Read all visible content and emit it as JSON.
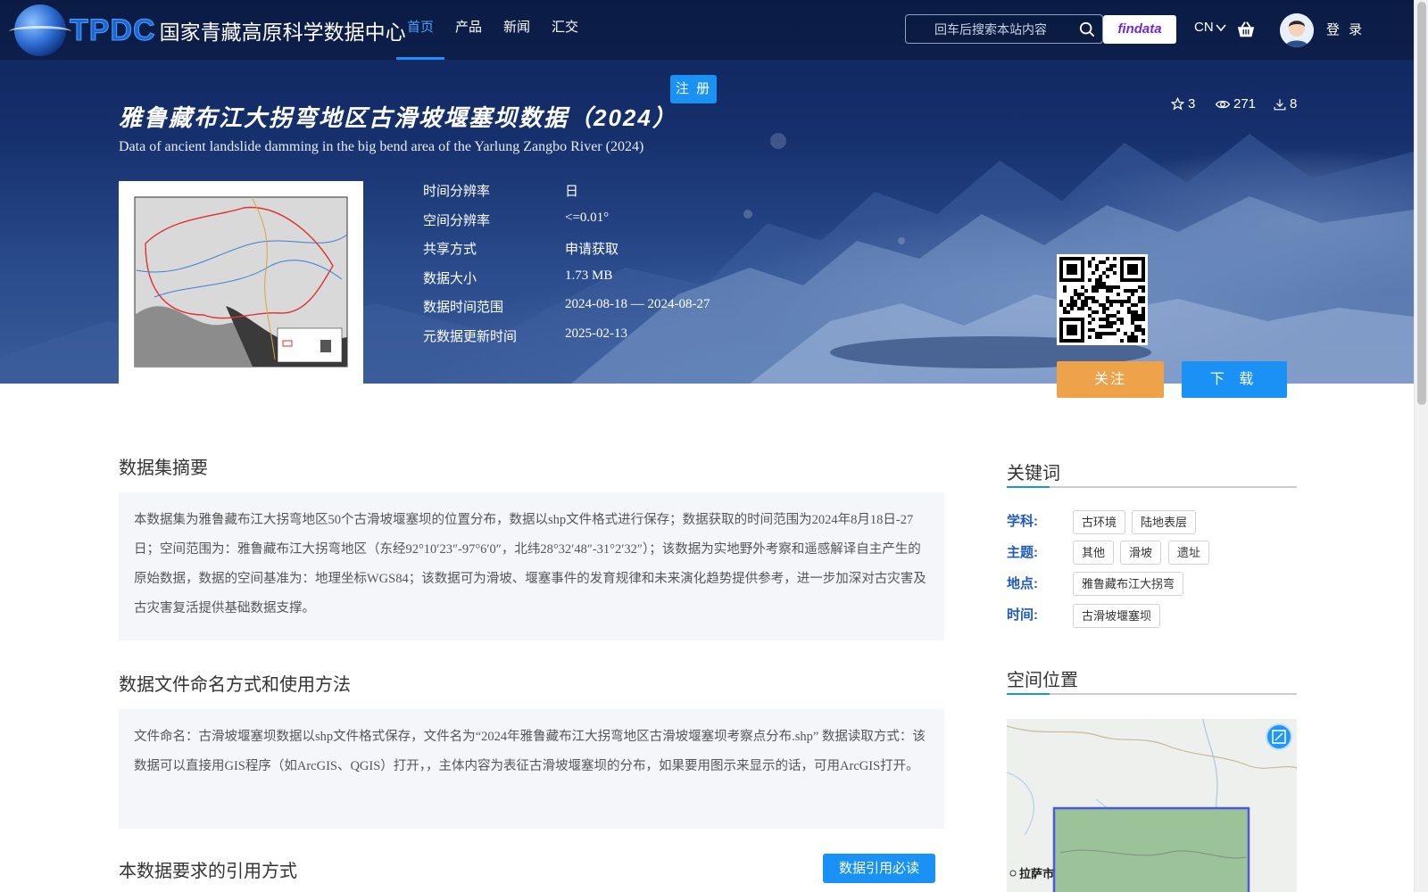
{
  "brand": {
    "logo_text": "TPDC",
    "site_name": "国家青藏高原科学数据中心"
  },
  "nav": {
    "items": [
      "首页",
      "产品",
      "新闻",
      "汇交"
    ],
    "active_index": 0
  },
  "header": {
    "search_placeholder": "回车后搜索本站内容",
    "findata_label": "findata",
    "lang_label": "CN",
    "login_label": "登 录",
    "register_label": "注 册"
  },
  "dataset": {
    "title_cn": "雅鲁藏布江大拐弯地区古滑坡堰塞坝数据（2024）",
    "title_en": "Data of ancient landslide damming in the big bend area of the Yarlung Zangbo River (2024)",
    "stats": {
      "stars": "3",
      "views": "271",
      "downloads": "8"
    },
    "meta": [
      {
        "key": "时间分辨率",
        "value": "日"
      },
      {
        "key": "空间分辨率",
        "value": "<=0.01°"
      },
      {
        "key": "共享方式",
        "value": "申请获取"
      },
      {
        "key": "数据大小",
        "value": "1.73 MB"
      },
      {
        "key": "数据时间范围",
        "value": "2024-08-18 — 2024-08-27"
      },
      {
        "key": "元数据更新时间",
        "value": "2025-02-13"
      }
    ],
    "follow_label": "关注",
    "download_label": "下 载"
  },
  "sections": {
    "abstract_title": "数据集摘要",
    "abstract_text": "本数据集为雅鲁藏布江大拐弯地区50个古滑坡堰塞坝的位置分布，数据以shp文件格式进行保存；数据获取的时间范围为2024年8月18日-27日；空间范围为：雅鲁藏布江大拐弯地区（东经92°10′23″-97°6′0″，北纬28°32′48″-31°2′32″）；该数据为实地野外考察和遥感解译自主产生的原始数据，数据的空间基准为：地理坐标WGS84；该数据可为滑坡、堰塞事件的发育规律和未来演化趋势提供参考，进一步加深对古灾害及古灾害复活提供基础数据支撑。",
    "naming_title": "数据文件命名方式和使用方法",
    "naming_text": "文件命名：古滑坡堰塞坝数据以shp文件格式保存，文件名为“2024年雅鲁藏布江大拐弯地区古滑坡堰塞坝考察点分布.shp” 数据读取方式：该数据可以直接用GIS程序（如ArcGIS、QGIS）打开，，主体内容为表征古滑坡堰塞坝的分布，如果要用图示来显示的话，可用ArcGIS打开。",
    "citation_title": "本数据要求的引用方式",
    "citation_button": "数据引用必读"
  },
  "sidebar": {
    "keywords_title": "关键词",
    "keywords": [
      {
        "label": "学科:",
        "tags": [
          "古环境",
          "陆地表层"
        ]
      },
      {
        "label": "主题:",
        "tags": [
          "其他",
          "滑坡",
          "遗址"
        ]
      },
      {
        "label": "地点:",
        "tags": [
          "雅鲁藏布江大拐弯"
        ]
      },
      {
        "label": "时间:",
        "tags": [
          "古滑坡堰塞坝"
        ]
      }
    ],
    "location_title": "空间位置",
    "map_label": "拉萨市"
  },
  "colors": {
    "accent": "#1a92f5",
    "follow": "#eea24a",
    "keyword_label": "#1f5bb8"
  }
}
